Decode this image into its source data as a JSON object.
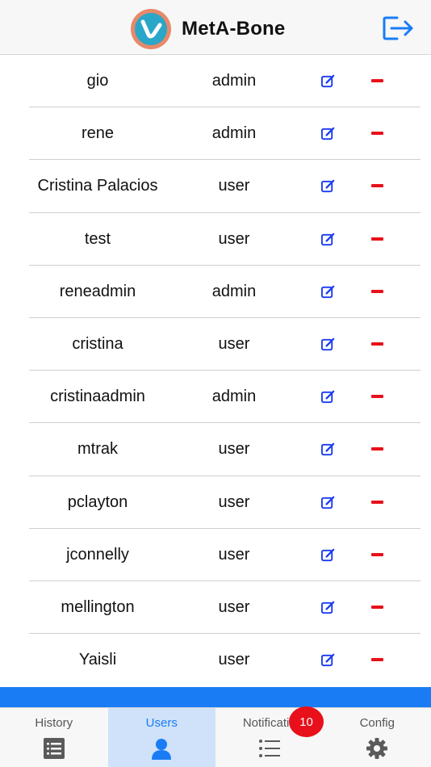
{
  "header": {
    "title": "MetA-Bone",
    "logo_icon": "app-logo-icon",
    "logout_icon": "logout-icon",
    "colors": {
      "logo_ring": "#e8896a",
      "logo_fill": "#2aa6c8",
      "accent": "#1a7cf5"
    }
  },
  "users": [
    {
      "name": "gio",
      "role": "admin"
    },
    {
      "name": "rene",
      "role": "admin"
    },
    {
      "name": "Cristina Palacios",
      "role": "user"
    },
    {
      "name": "test",
      "role": "user"
    },
    {
      "name": "reneadmin",
      "role": "admin"
    },
    {
      "name": "cristina",
      "role": "user"
    },
    {
      "name": "cristinaadmin",
      "role": "admin"
    },
    {
      "name": "mtrak",
      "role": "user"
    },
    {
      "name": "pclayton",
      "role": "user"
    },
    {
      "name": "jconnelly",
      "role": "user"
    },
    {
      "name": "mellington",
      "role": "user"
    },
    {
      "name": "Yaisli",
      "role": "user"
    }
  ],
  "row_actions": {
    "edit_icon": "edit-icon",
    "delete_icon": "minus-icon",
    "delete_color": "#e8101a",
    "edit_color": "#1a3cf0"
  },
  "tabs": [
    {
      "label": "History",
      "icon": "list-box-icon"
    },
    {
      "label": "Users",
      "icon": "person-icon",
      "active": true
    },
    {
      "label": "Notificatio",
      "icon": "list-icon",
      "badge": "10"
    },
    {
      "label": "Config",
      "icon": "gear-icon"
    }
  ]
}
